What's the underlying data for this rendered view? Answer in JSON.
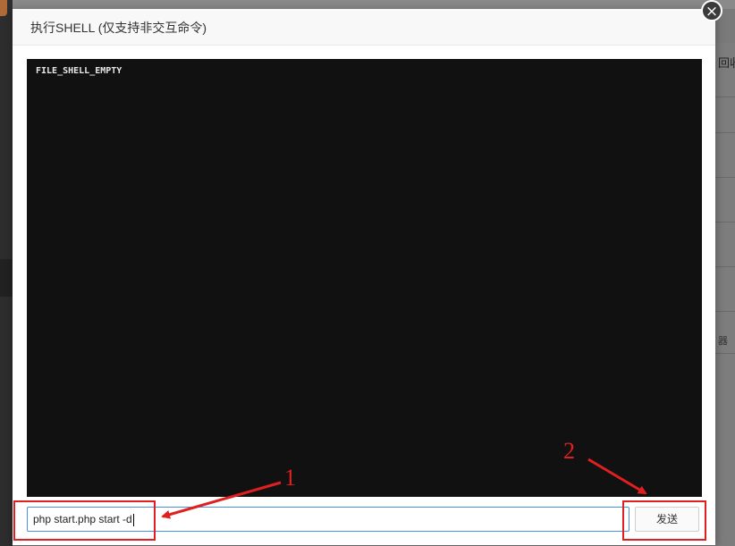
{
  "background": {
    "right_text": "回收",
    "right_text2": "器"
  },
  "dialog": {
    "title": "执行SHELL (仅支持非交互命令)",
    "close_glyph": "×",
    "terminal_output": "FILE_SHELL_EMPTY",
    "command_value": "php start.php start -d",
    "send_label": "发送"
  },
  "annotations": {
    "step1": "1",
    "step2": "2",
    "color": "#e02020"
  },
  "colors": {
    "terminal_bg": "#111111",
    "input_focus_border": "#4a90e2"
  }
}
